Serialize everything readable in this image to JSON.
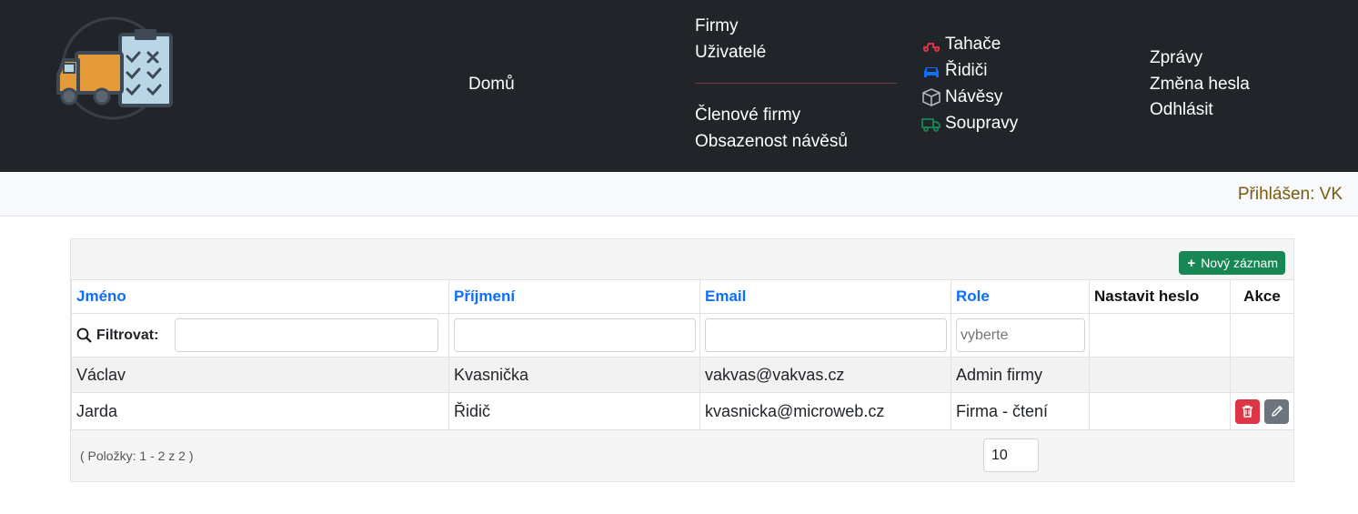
{
  "navbar": {
    "home": "Domů",
    "companies": "Firmy",
    "users": "Uživatelé",
    "company_members": "Členové firmy",
    "trailer_occupancy": "Obsazenost návěsů",
    "tractors": "Tahače",
    "drivers": "Řidiči",
    "trailers": "Návěsy",
    "combinations": "Soupravy",
    "messages": "Zprávy",
    "change_password": "Změna hesla",
    "logout": "Odhlásit",
    "icon_colors": {
      "tractors": "#dc3545",
      "drivers": "#0d6efd",
      "trailers": "#adb5bd",
      "combinations": "#198754"
    }
  },
  "status": {
    "logged_in": "Přihlášen: VK"
  },
  "grid": {
    "new_record": "Nový záznam",
    "columns": {
      "first_name": "Jméno",
      "last_name": "Příjmení",
      "email": "Email",
      "role": "Role",
      "set_password": "Nastavit heslo",
      "actions": "Akce"
    },
    "filter": {
      "label": "Filtrovat:",
      "role_placeholder": "vyberte"
    },
    "rows": [
      {
        "first_name": "Václav",
        "last_name": "Kvasnička",
        "email": "vakvas@vakvas.cz",
        "role": "Admin firmy"
      },
      {
        "first_name": "Jarda",
        "last_name": "Řidič",
        "email": "kvasnicka@microweb.cz",
        "role": "Firma - čtení"
      }
    ],
    "pager_info": "( Položky: 1 - 2 z 2 )",
    "page_size": "10"
  }
}
